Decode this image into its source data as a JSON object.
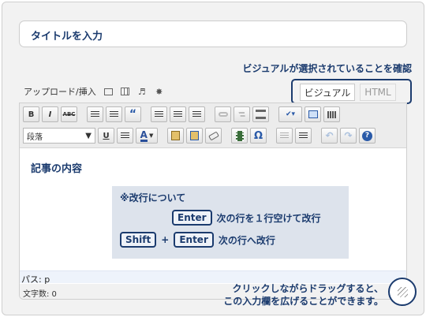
{
  "title_placeholder": "タイトルを入力",
  "confirm_note": "ビジュアルが選択されていることを確認",
  "upload": {
    "label": "アップロード/挿入",
    "icons": [
      "image-icon",
      "gallery-icon",
      "music-icon",
      "media-icon"
    ],
    "music_glyph": "♬",
    "media_glyph": "✸"
  },
  "tabs": {
    "visual": "ビジュアル",
    "html": "HTML"
  },
  "toolbar": {
    "bold": "B",
    "italic": "I",
    "strike": "ABC",
    "quote": "“",
    "format_select": "段落",
    "underline": "U",
    "text_color": "A",
    "omega": "Ω",
    "help": "?"
  },
  "content": {
    "heading": "記事の内容",
    "info_title": "※改行について",
    "line1_key": "Enter",
    "line1_text": "次の行を１行空けて改行",
    "line2_key1": "Shift",
    "line2_plus": "+",
    "line2_key2": "Enter",
    "line2_text": "次の行へ改行"
  },
  "path_label": "パス: p",
  "char_count": "文字数: 0",
  "resize_note_line1": "クリックしながらドラッグすると、",
  "resize_note_line2": "この入力欄を広げることができます。",
  "colors": {
    "accent": "#1b3b6e",
    "info_bg": "#dde3ec"
  }
}
